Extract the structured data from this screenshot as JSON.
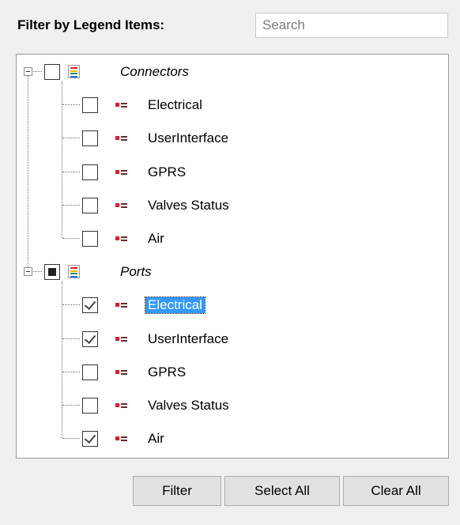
{
  "header": {
    "label": "Filter by Legend Items:"
  },
  "search": {
    "placeholder": "Search",
    "value": ""
  },
  "colors": {
    "swatch": "#e31b23",
    "icon_lines": [
      "#e31b23",
      "#f7b500",
      "#2e8b57",
      "#1f6fd1"
    ],
    "selection": "#3399ff"
  },
  "tree": {
    "groups": [
      {
        "label": "Connectors",
        "icon": "legend-group-icon",
        "state": "unchecked",
        "items": [
          {
            "label": "Electrical",
            "checked": false
          },
          {
            "label": "UserInterface",
            "checked": false
          },
          {
            "label": "GPRS",
            "checked": false
          },
          {
            "label": "Valves Status",
            "checked": false
          },
          {
            "label": "Air",
            "checked": false
          }
        ]
      },
      {
        "label": "Ports",
        "icon": "legend-group-icon",
        "state": "partial",
        "items": [
          {
            "label": "Electrical",
            "checked": true,
            "selected": true
          },
          {
            "label": "UserInterface",
            "checked": true
          },
          {
            "label": "GPRS",
            "checked": false
          },
          {
            "label": "Valves Status",
            "checked": false
          },
          {
            "label": "Air",
            "checked": true
          }
        ]
      }
    ]
  },
  "buttons": {
    "filter": "Filter",
    "select_all": "Select All",
    "clear_all": "Clear All"
  }
}
